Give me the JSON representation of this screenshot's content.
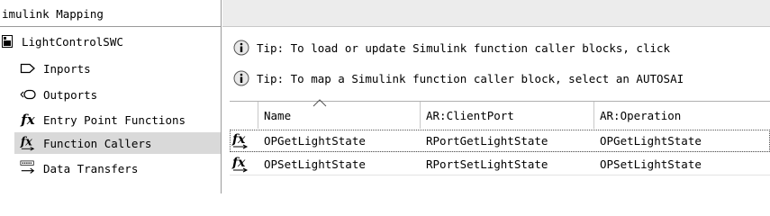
{
  "tree": {
    "header": "imulink Mapping",
    "root": {
      "label": "LightControlSWC",
      "icon": "component-icon"
    },
    "items": [
      {
        "label": "Inports",
        "icon": "inport-icon"
      },
      {
        "label": "Outports",
        "icon": "outport-icon"
      },
      {
        "label": "Entry Point Functions",
        "icon": "fx-icon"
      },
      {
        "label": "Function Callers",
        "icon": "fx-caller-icon",
        "selected": true
      },
      {
        "label": "Data Transfers",
        "icon": "data-transfer-icon"
      }
    ]
  },
  "tips": [
    {
      "text": "Tip: To load or update Simulink function caller blocks, click ",
      "icon": "info-icon"
    },
    {
      "text": "Tip: To map a Simulink function caller block, select an AUTOSAI",
      "icon": "info-icon"
    }
  ],
  "table": {
    "columns": [
      "Name",
      "AR:ClientPort",
      "AR:Operation"
    ],
    "sort_column": "Name",
    "rows": [
      {
        "icon": "fx-caller-icon",
        "name": "OPGetLightState",
        "client_port": "RPortGetLightState",
        "operation": "OPGetLightState"
      },
      {
        "icon": "fx-caller-icon",
        "name": "OPSetLightState",
        "client_port": "RPortSetLightState",
        "operation": "OPSetLightState"
      }
    ]
  }
}
